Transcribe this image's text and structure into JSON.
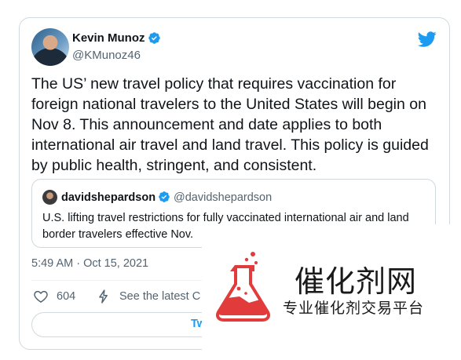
{
  "tweet": {
    "author_name": "Kevin Munoz",
    "author_handle": "@KMunoz46",
    "text": "The US’ new travel policy that requires vaccination for foreign national travelers to the United States will begin on Nov 8. This announcement and date applies to both international air travel and land travel. This policy is guided by public health, stringent, and consistent.",
    "timestamp": "5:49 AM · Oct 15, 2021",
    "like_count": "604",
    "see_latest_label": "See the latest C",
    "tweet_button_label": "Tw"
  },
  "quoted_tweet": {
    "author_name": "davidshepardson",
    "author_handle": "@davidshepardson",
    "text": "U.S. lifting travel restrictions for fully vaccinated international air and land border travelers effective Nov."
  },
  "watermark": {
    "title": "催化剂网",
    "subtitle": "专业催化剂交易平台"
  },
  "icons": {
    "verified": "verified-badge-icon",
    "twitter": "twitter-bird-icon",
    "like": "heart-icon",
    "latest": "lightning-icon"
  },
  "colors": {
    "brand_blue": "#1d9bf0",
    "muted_text": "#536471",
    "border": "#cfd9de",
    "watermark_red": "#e23b3b"
  }
}
